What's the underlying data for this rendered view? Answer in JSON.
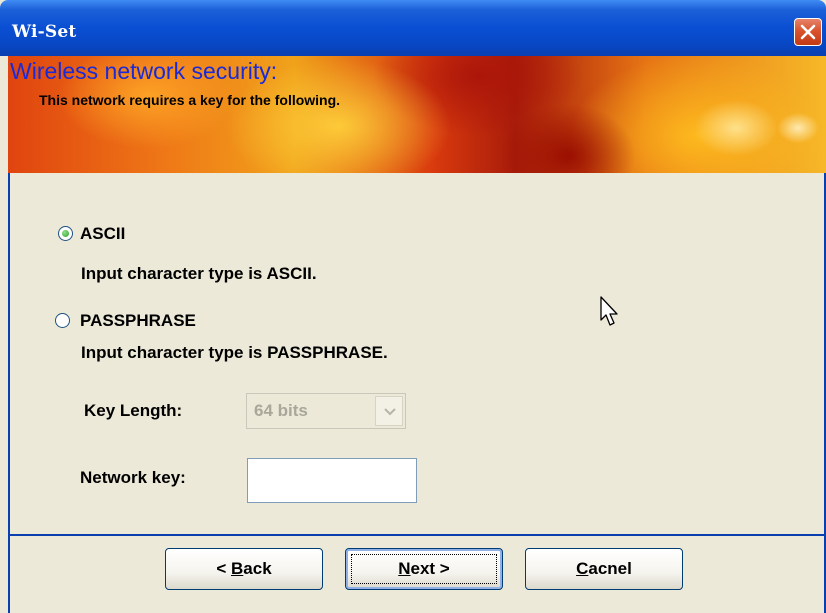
{
  "window": {
    "title": "Wi-Set"
  },
  "banner": {
    "title": "Wireless network security:",
    "subtitle": "This network requires a key for the following."
  },
  "options": [
    {
      "label": "ASCII",
      "description": "Input character type is ASCII.",
      "selected": true
    },
    {
      "label": "PASSPHRASE",
      "description": "Input character type is PASSPHRASE.",
      "selected": false
    }
  ],
  "key_length": {
    "label": "Key Length:",
    "value": "64 bits",
    "enabled": false
  },
  "network_key": {
    "label": "Network key:",
    "value": ""
  },
  "buttons": {
    "back": {
      "prefix": "< ",
      "mnemonic": "B",
      "rest": "ack"
    },
    "next": {
      "mnemonic": "N",
      "rest": "ext >"
    },
    "cancel": {
      "mnemonic": "C",
      "rest": "acnel"
    }
  },
  "icons": [
    "close-icon",
    "radio-icon",
    "dropdown-arrow-icon",
    "mouse-pointer-icon"
  ],
  "colors": {
    "title_bar": "#0a4fd3",
    "banner_title": "#1a2ad8",
    "dialog_bg": "#ece9d8",
    "close_button": "#d9542e"
  }
}
